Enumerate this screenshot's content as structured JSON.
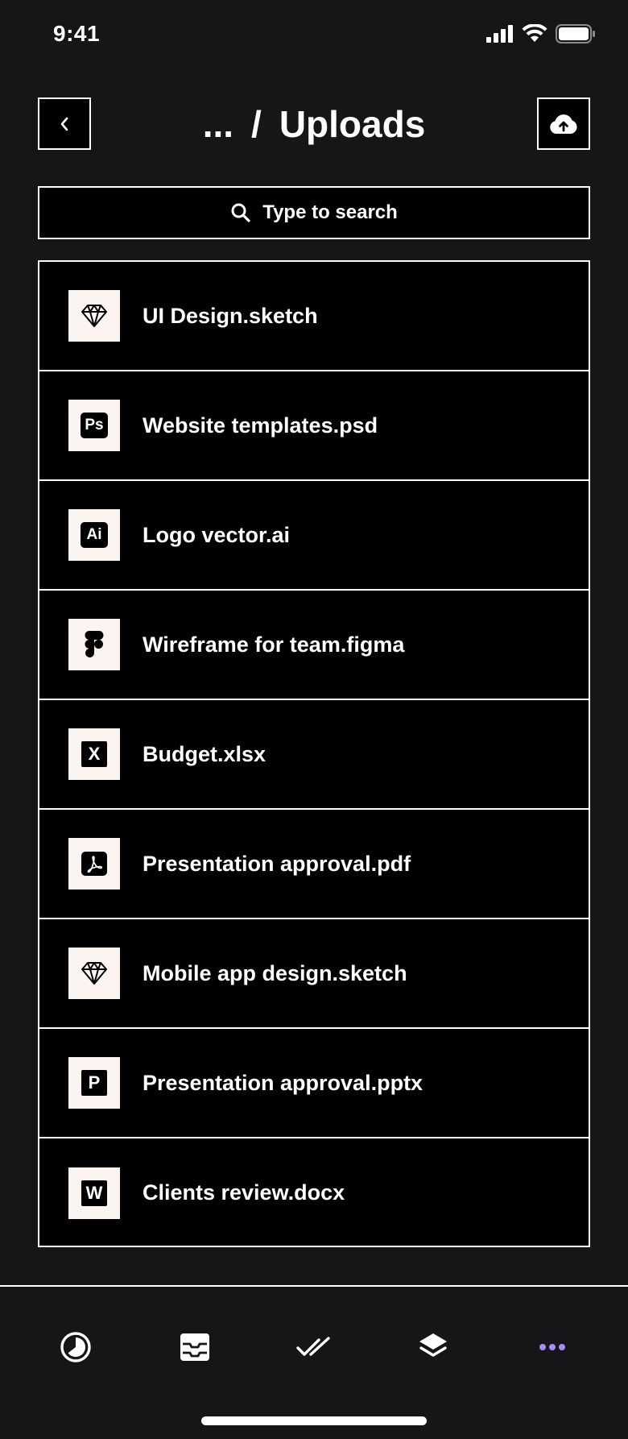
{
  "status": {
    "time": "9:41"
  },
  "header": {
    "ellipsis": "...",
    "separator": "/",
    "title": "Uploads"
  },
  "search": {
    "placeholder": "Type to search"
  },
  "files": [
    {
      "name": "UI Design.sketch",
      "icon": "sketch-icon"
    },
    {
      "name": "Website templates.psd",
      "icon": "photoshop-icon",
      "badge": "Ps"
    },
    {
      "name": "Logo vector.ai",
      "icon": "illustrator-icon",
      "badge": "Ai"
    },
    {
      "name": "Wireframe for team.figma",
      "icon": "figma-icon"
    },
    {
      "name": "Budget.xlsx",
      "icon": "excel-icon",
      "badge": "X"
    },
    {
      "name": "Presentation approval.pdf",
      "icon": "pdf-icon"
    },
    {
      "name": "Mobile app design.sketch",
      "icon": "sketch-icon"
    },
    {
      "name": "Presentation approval.pptx",
      "icon": "powerpoint-icon",
      "badge": "P"
    },
    {
      "name": "Clients review.docx",
      "icon": "word-icon",
      "badge": "W"
    }
  ],
  "tabs": [
    {
      "icon": "dashboard-icon"
    },
    {
      "icon": "inbox-icon"
    },
    {
      "icon": "tasks-icon"
    },
    {
      "icon": "layers-icon"
    },
    {
      "icon": "more-icon",
      "active": true
    }
  ],
  "colors": {
    "background": "#161618",
    "surface": "#000000",
    "icon_tile": "#fbf4f0",
    "accent": "#a78bfa"
  }
}
